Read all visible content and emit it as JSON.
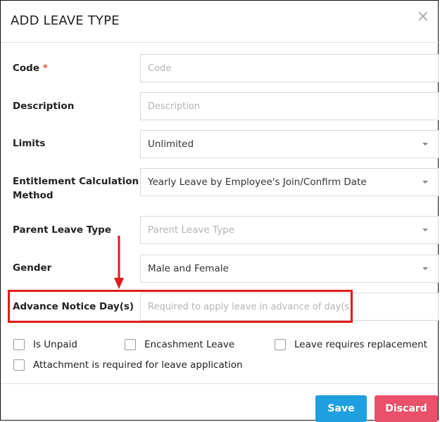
{
  "modal": {
    "title": "ADD LEAVE TYPE",
    "close_symbol": "×"
  },
  "form": {
    "code": {
      "label": "Code",
      "required_marker": "*",
      "placeholder": "Code",
      "value": ""
    },
    "description": {
      "label": "Description",
      "placeholder": "Description",
      "value": ""
    },
    "limits": {
      "label": "Limits",
      "selected": "Unlimited"
    },
    "entitlement": {
      "label_line1": "Entitlement Calculation",
      "label_line2": "Method",
      "selected": "Yearly Leave by Employee's Join/Confirm Date"
    },
    "parent_leave_type": {
      "label": "Parent Leave Type",
      "placeholder": "Parent Leave Type"
    },
    "gender": {
      "label": "Gender",
      "selected": "Male and Female"
    },
    "advance_notice": {
      "label": "Advance Notice Day(s)",
      "placeholder": "Required to apply leave in advance of day(s)",
      "value": ""
    }
  },
  "checkboxes": {
    "is_unpaid": {
      "label": "Is Unpaid",
      "checked": false
    },
    "encashment": {
      "label": "Encashment Leave",
      "checked": false
    },
    "replacement": {
      "label": "Leave requires replacement",
      "checked": false
    },
    "attachment": {
      "label": "Attachment is required for leave application",
      "checked": false
    }
  },
  "footer": {
    "save_label": "Save",
    "discard_label": "Discard"
  },
  "annotation": {
    "highlight_color": "#e01b1b"
  }
}
